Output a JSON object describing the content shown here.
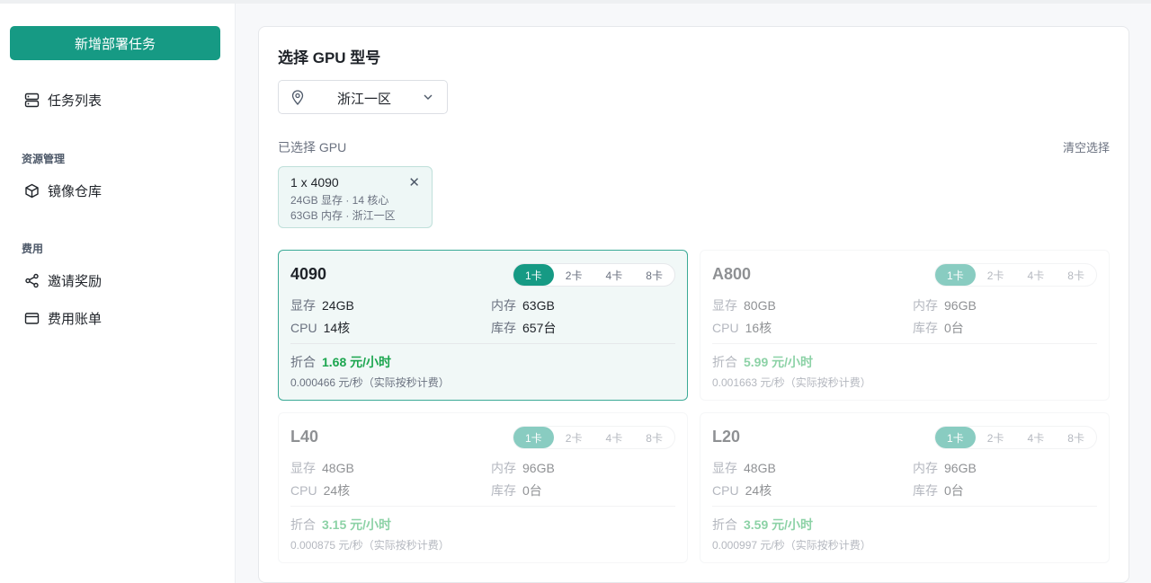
{
  "sidebar": {
    "new_task_label": "新增部署任务",
    "items": [
      {
        "label": "任务列表",
        "icon": "server-list-icon"
      },
      {
        "label": "镜像仓库",
        "icon": "cube-icon"
      },
      {
        "label": "邀请奖励",
        "icon": "share-icon"
      },
      {
        "label": "费用账单",
        "icon": "card-icon"
      }
    ],
    "sections": {
      "resource": "资源管理",
      "billing": "费用"
    }
  },
  "main": {
    "title": "选择 GPU 型号",
    "region": {
      "value": "浙江一区",
      "icon": "location-pin-icon"
    },
    "selected_label": "已选择 GPU",
    "clear_label": "清空选择",
    "chip": {
      "title": "1 x 4090",
      "line1": "24GB 显存 · 14 核心",
      "line2": "63GB 内存 · 浙江一区"
    },
    "labels": {
      "vram": "显存",
      "cpu": "CPU",
      "mem": "内存",
      "stock": "库存",
      "price": "折合"
    },
    "card_options": [
      "1卡",
      "2卡",
      "4卡",
      "8卡"
    ],
    "cards": [
      {
        "name": "4090",
        "vram": "24GB",
        "cpu": "14核",
        "mem": "63GB",
        "stock": "657台",
        "price": "1.68 元/小时",
        "per_sec": "0.000466 元/秒（实际按秒计费）",
        "selected_option": "1卡",
        "state": "selected"
      },
      {
        "name": "A800",
        "vram": "80GB",
        "cpu": "16核",
        "mem": "96GB",
        "stock": "0台",
        "price": "5.99 元/小时",
        "per_sec": "0.001663 元/秒（实际按秒计费）",
        "selected_option": "1卡",
        "state": "unavailable"
      },
      {
        "name": "L40",
        "vram": "48GB",
        "cpu": "24核",
        "mem": "96GB",
        "stock": "0台",
        "price": "3.15 元/小时",
        "per_sec": "0.000875 元/秒（实际按秒计费）",
        "selected_option": "1卡",
        "state": "unavailable"
      },
      {
        "name": "L20",
        "vram": "48GB",
        "cpu": "24核",
        "mem": "96GB",
        "stock": "0台",
        "price": "3.59 元/小时",
        "per_sec": "0.000997 元/秒（实际按秒计费）",
        "selected_option": "1卡",
        "state": "unavailable"
      }
    ]
  },
  "colors": {
    "accent": "#169a84",
    "price_green": "#1ca64f"
  }
}
